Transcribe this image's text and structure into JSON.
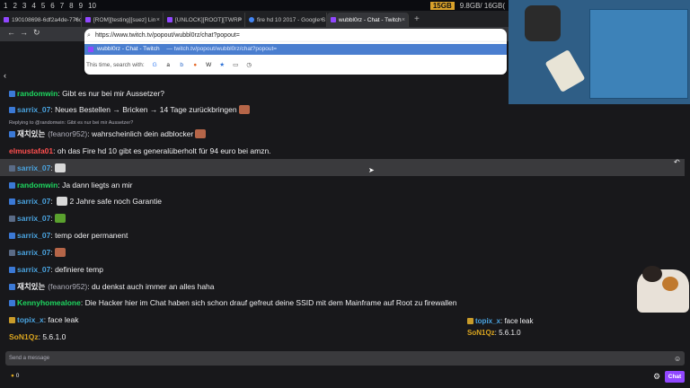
{
  "sysbar": {
    "workspaces": [
      "1",
      "2",
      "3",
      "4",
      "5",
      "6",
      "7",
      "8",
      "9",
      "10"
    ],
    "disk": "15GB",
    "mem": "9.8GB/ 16GB("
  },
  "browser": {
    "tabs": [
      {
        "title": "190108698-6df2a4de-776c",
        "active": false
      },
      {
        "title": "[ROM][testing][suez] Lin",
        "active": false
      },
      {
        "title": "[UNLOCK][ROOT][TWRP",
        "active": false
      },
      {
        "title": "fire hd 10 2017 - Google S",
        "active": false
      },
      {
        "title": "wubbl0rz - Chat - Twitch",
        "active": true
      }
    ],
    "new_tab": "+",
    "url_value": "https://www.twitch.tv/popout/wubbl0rz/chat?popout=",
    "suggestion_title": "wubbl0rz - Chat - Twitch",
    "suggestion_url": "— twitch.tv/popout/wubbl0rz/chat?popout=",
    "search_with": "This time, search with:"
  },
  "chat": {
    "messages": [
      {
        "user": "randomwin",
        "color": "#1ed760",
        "badge": "blue",
        "text": ": Gibt es nur bei mir Aussetzer?"
      },
      {
        "user": "sarrix_07",
        "color": "#4aa3df",
        "badge": "blue",
        "text": ": Neues Bestellen → Bricken → 14 Tage zurückbringen",
        "emote": "face"
      },
      {
        "user": "재치있는",
        "sub": "(feanor952)",
        "color": "#efeff1",
        "badge": "blue",
        "text": ": wahrscheinlich dein adblocker",
        "emote": "face"
      },
      {
        "user": "elmustafa01",
        "color": "#ff4f4f",
        "badge": "",
        "text": ": oh das Fire hd 10 gibt es generalüberholt für 94 euro bei amzn."
      },
      {
        "user": "sarrix_07",
        "color": "#4aa3df",
        "badge": "gray",
        "text": ":",
        "emote": "white"
      },
      {
        "user": "randomwin",
        "color": "#1ed760",
        "badge": "blue",
        "text": ": Ja dann liegts an mir"
      },
      {
        "user": "sarrix_07",
        "color": "#4aa3df",
        "badge": "blue",
        "text": ": 2 Jahre safe noch Garantie",
        "emote_before": "white"
      },
      {
        "user": "sarrix_07",
        "color": "#4aa3df",
        "badge": "gray",
        "text": ":",
        "emote": "pepe"
      },
      {
        "user": "sarrix_07",
        "color": "#4aa3df",
        "badge": "blue",
        "text": ": temp oder permanent"
      },
      {
        "user": "sarrix_07",
        "color": "#4aa3df",
        "badge": "gray",
        "text": ":",
        "emote": "face"
      },
      {
        "user": "sarrix_07",
        "color": "#4aa3df",
        "badge": "blue",
        "text": ": definiere temp"
      },
      {
        "user": "재치있는",
        "sub": "(feanor952)",
        "color": "#efeff1",
        "badge": "blue",
        "text": ": du denkst auch immer an alles haha"
      },
      {
        "user": "Kennyhomealone",
        "color": "#1ed760",
        "badge": "blue",
        "text": ": Die Hacker hier im Chat haben sich schon drauf gefreut deine SSID mit dem Mainframe auf Root zu firewallen"
      },
      {
        "user": "topix_x",
        "color": "#4aa3df",
        "badge": "gold",
        "text": ": face leak"
      },
      {
        "user": "SoN1Qz",
        "color": "#daa520",
        "badge": "",
        "text": ": 5.6.1.0"
      }
    ],
    "reply_hint": "Replying to @randomwin: Gibt es nur bei mir Aussetzer?",
    "input_placeholder": "Send a message",
    "points": "0",
    "chat_button": "Chat"
  },
  "overlay": {
    "lines": [
      {
        "user": "topix_x",
        "text": ": face leak",
        "color": "#4aa3df"
      },
      {
        "user": "SoN1Qz",
        "text": ": 5.6.1.0",
        "color": "#daa520"
      }
    ]
  }
}
